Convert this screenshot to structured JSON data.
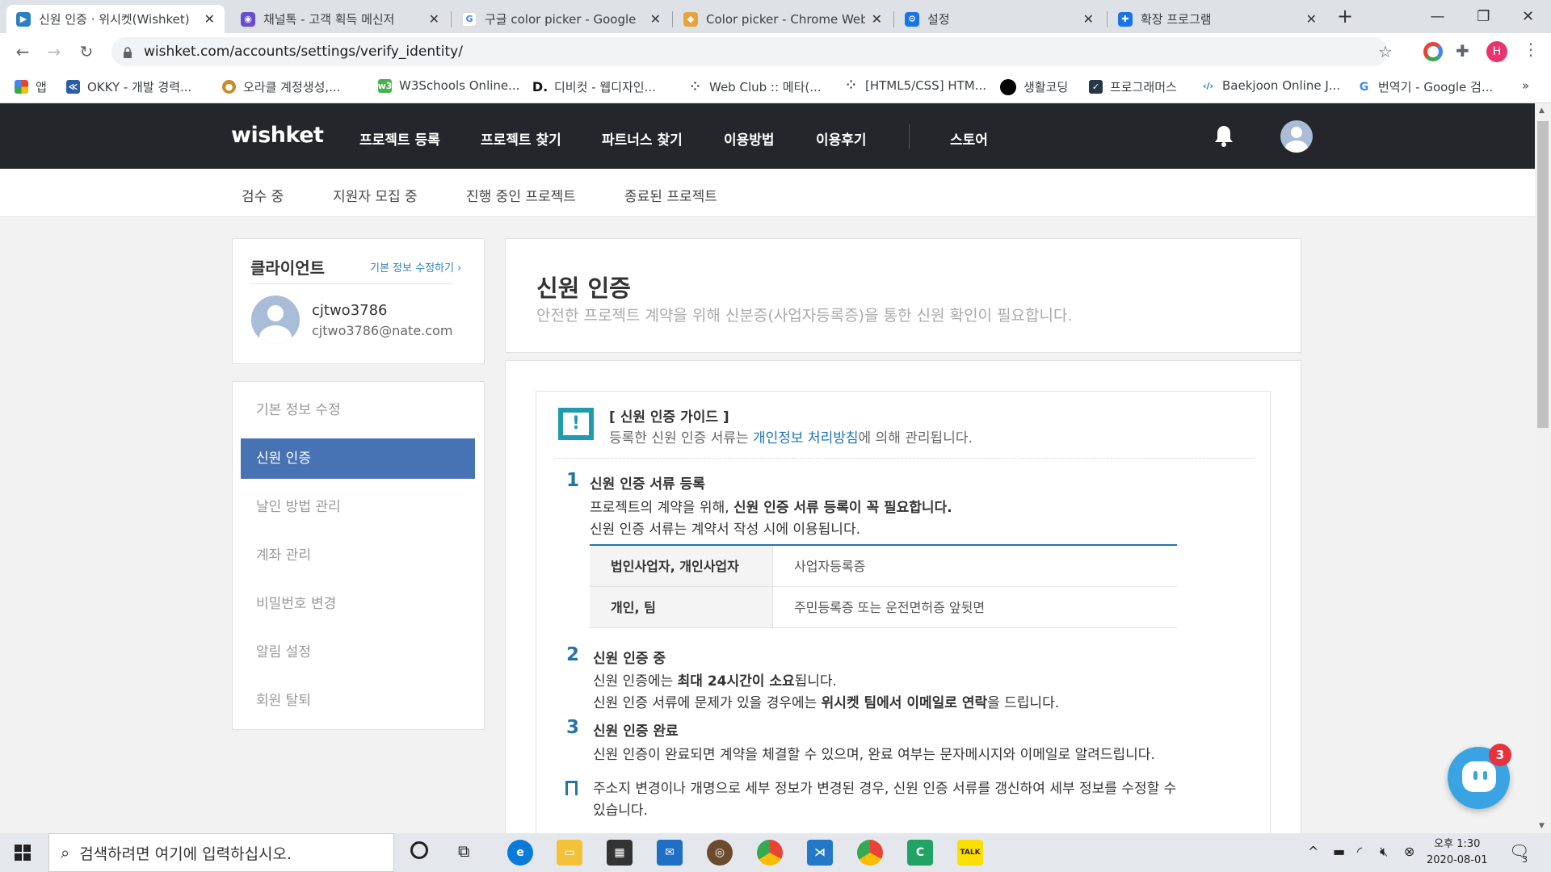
{
  "browser": {
    "tabs": [
      {
        "title": "신원 인증 · 위시켓(Wishket)",
        "color": "#2d7fc1"
      },
      {
        "title": "채널톡 - 고객 획득 메신저",
        "color": "#6b4bd3"
      },
      {
        "title": "구글 color picker - Google",
        "color": "#4285f4"
      },
      {
        "title": "Color picker - Chrome Web",
        "color": "#e8a33d"
      },
      {
        "title": "설정",
        "color": "#1a73e8"
      },
      {
        "title": "확장 프로그램",
        "color": "#1a73e8"
      }
    ],
    "new_tab": "+",
    "url": "wishket.com/accounts/settings/verify_identity/",
    "profile_initial": "H",
    "bookmarks": [
      {
        "label": "앱",
        "color": "#ea4335"
      },
      {
        "label": "OKKY - 개발 경력...",
        "color": "#2c5ba8"
      },
      {
        "label": "오라클 계정생성,...",
        "color": "#c98a2a"
      },
      {
        "label": "W3Schools Online...",
        "color": "#4caf50"
      },
      {
        "label": "디비컷 - 웹디자인...",
        "color": "#111111"
      },
      {
        "label": "Web Club :: 메타(...",
        "color": "#333333"
      },
      {
        "label": "[HTML5/CSS] HTM...",
        "color": "#333333"
      },
      {
        "label": "생활코딩",
        "color": "#000000"
      },
      {
        "label": "프로그래머스",
        "color": "#263747"
      },
      {
        "label": "Baekjoon Online J...",
        "color": "#0076c0"
      },
      {
        "label": "번역기 - Google 검...",
        "color": "#4285f4"
      }
    ],
    "bookmarks_more": "»"
  },
  "site": {
    "logo": "wishket",
    "gnb": [
      "프로젝트 등록",
      "프로젝트 찾기",
      "파트너스 찾기",
      "이용방법",
      "이용후기",
      "스토어"
    ],
    "subnav": [
      "검수 중",
      "지원자 모집 중",
      "진행 중인 프로젝트",
      "종료된 프로젝트"
    ]
  },
  "profile": {
    "title": "클라이언트",
    "edit_link": "기본 정보 수정하기",
    "username": "cjtwo3786",
    "email": "cjtwo3786@nate.com"
  },
  "sidebar": {
    "items": [
      "기본 정보 수정",
      "신원 인증",
      "날인 방법 관리",
      "계좌 관리",
      "비밀번호 변경",
      "알림 설정",
      "회원 탈퇴"
    ],
    "active": "신원 인증"
  },
  "main": {
    "title": "신원 인증",
    "subtitle": "안전한 프로젝트 계약을 위해 신분증(사업자등록증)을 통한 신원 확인이 필요합니다.",
    "guide_title": "[ 신원 인증 가이드 ]",
    "guide_text_pre": "등록한 신원 인증 서류는 ",
    "guide_link": "개인정보 처리방침",
    "guide_text_post": "에 의해 관리됩니다.",
    "steps": [
      {
        "num": "1",
        "title": "신원 인증 서류 등록",
        "lines": [
          "프로젝트의 계약을 위해, ",
          "신원 인증 서류 등록이 꼭 필요합니다.",
          "신원 인증 서류는 계약서 작성 시에 이용됩니다."
        ]
      },
      {
        "num": "2",
        "title": "신원 인증 중",
        "lines": [
          "신원 인증에는 ",
          "최대 24시간이 소요",
          "됩니다.",
          "신원 인증 서류에 문제가 있을 경우에는 ",
          "위시켓 팀에서 이메일로 연락",
          "을 드립니다."
        ]
      },
      {
        "num": "3",
        "title": "신원 인증 완료",
        "lines": [
          "신원 인증이 완료되면 계약을 체결할 수 있으며, 완료 여부는 문자메시지와 이메일로 알려드립니다."
        ]
      }
    ],
    "table": [
      {
        "type": "법인사업자, 개인사업자",
        "doc": "사업자등록증"
      },
      {
        "type": "개인, 팀",
        "doc": "주민등록증 또는 운전면허증 앞뒷면"
      }
    ],
    "note_line1": "주소지 변경이나 개명으로 세부 정보가 변경된 경우, 신원 인증 서류를 갱신하여 세부 정보를 수정할 수",
    "note_line2": "있습니다."
  },
  "chat": {
    "badge": "3"
  },
  "taskbar": {
    "search_placeholder": "검색하려면 여기에 입력하십시오.",
    "time_period": "오후 1:30",
    "date": "2020-08-01",
    "notification_count": "3"
  }
}
